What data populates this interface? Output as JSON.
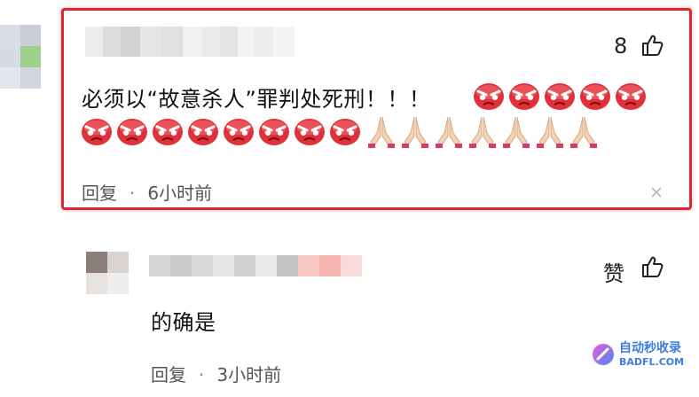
{
  "comment1": {
    "like_count": "8",
    "text": "必须以“故意杀人”罪判处死刑！！！",
    "reply_label": "回复",
    "separator": "·",
    "time": "6小时前",
    "angry_emoji_count": 13,
    "pray_emoji_count": 7
  },
  "comment2": {
    "like_label": "赞",
    "text": "的确是",
    "reply_label": "回复",
    "separator": "·",
    "time": "3小时前"
  },
  "watermark": {
    "cn": "自动秒收录",
    "en": "BADFL.COM"
  },
  "colors": {
    "highlight": "#e0262b",
    "watermark": "#3f7be0"
  }
}
